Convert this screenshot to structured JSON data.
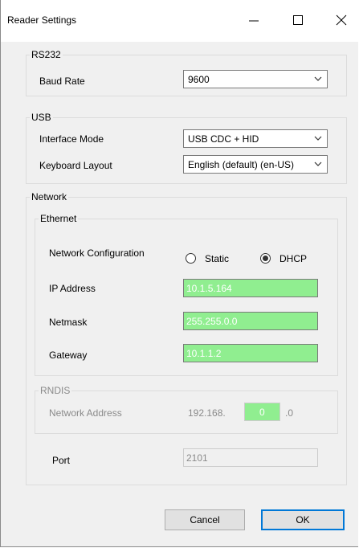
{
  "window": {
    "title": "Reader Settings"
  },
  "rs232": {
    "group_label": "RS232",
    "baud_rate_label": "Baud Rate",
    "baud_rate_value": "9600"
  },
  "usb": {
    "group_label": "USB",
    "interface_mode_label": "Interface Mode",
    "interface_mode_value": "USB CDC + HID",
    "keyboard_layout_label": "Keyboard Layout",
    "keyboard_layout_value": "English (default) (en-US)"
  },
  "network": {
    "group_label": "Network",
    "ethernet": {
      "group_label": "Ethernet",
      "config_label": "Network Configuration",
      "static_label": "Static",
      "dhcp_label": "DHCP",
      "selected": "DHCP",
      "ip_label": "IP Address",
      "ip_value": "10.1.5.164",
      "netmask_label": "Netmask",
      "netmask_value": "255.255.0.0",
      "gateway_label": "Gateway",
      "gateway_value": "10.1.1.2"
    },
    "rndis": {
      "group_label": "RNDIS",
      "address_label": "Network Address",
      "address_prefix": "192.168.",
      "address_octet": "0",
      "address_suffix": ".0"
    },
    "port_label": "Port",
    "port_value": "2101"
  },
  "buttons": {
    "cancel": "Cancel",
    "ok": "OK"
  },
  "colors": {
    "field_highlight": "#90ee90",
    "window_bg": "#f0f0f0",
    "default_button_border": "#0078d7"
  }
}
